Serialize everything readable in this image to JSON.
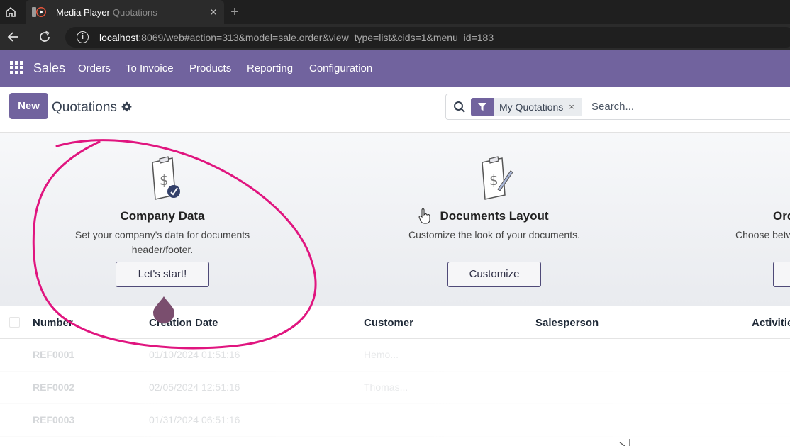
{
  "browser": {
    "tab": {
      "app_name": "Media Player",
      "page_title": "Quotations"
    },
    "url": {
      "host": "localhost",
      "rest": ":8069/web#action=313&model=sale.order&view_type=list&cids=1&menu_id=183"
    }
  },
  "odoo_nav": {
    "brand": "Sales",
    "menu": [
      "Orders",
      "To Invoice",
      "Products",
      "Reporting",
      "Configuration"
    ]
  },
  "control_panel": {
    "new_label": "New",
    "title": "Quotations",
    "facet_label": "My Quotations",
    "facet_remove": "×",
    "search_placeholder": "Search..."
  },
  "onboarding": {
    "steps": [
      {
        "title": "Company Data",
        "description": "Set your company's data for documents header/footer.",
        "button": "Let's start!"
      },
      {
        "title": "Documents Layout",
        "description": "Customize the look of your documents.",
        "button": "Customize"
      },
      {
        "title": "Ord",
        "description": "Choose betw",
        "button": ""
      }
    ]
  },
  "list": {
    "columns": [
      "Number",
      "Creation Date",
      "Customer",
      "Salesperson",
      "Activitie"
    ],
    "rows": [
      {
        "number": "REF0001",
        "date": "01/10/2024 01:51:16",
        "customer": "Hemo...",
        "salesperson": ""
      },
      {
        "number": "REF0002",
        "date": "02/05/2024 12:51:16",
        "customer": "Thomas...",
        "salesperson": ""
      },
      {
        "number": "REF0003",
        "date": "01/31/2024 06:51:16",
        "customer": "",
        "salesperson": ""
      }
    ]
  },
  "colors": {
    "odoo_purple": "#71639e",
    "annotation_pink": "#e0157f",
    "cursor_drop": "#7a4e6e"
  }
}
